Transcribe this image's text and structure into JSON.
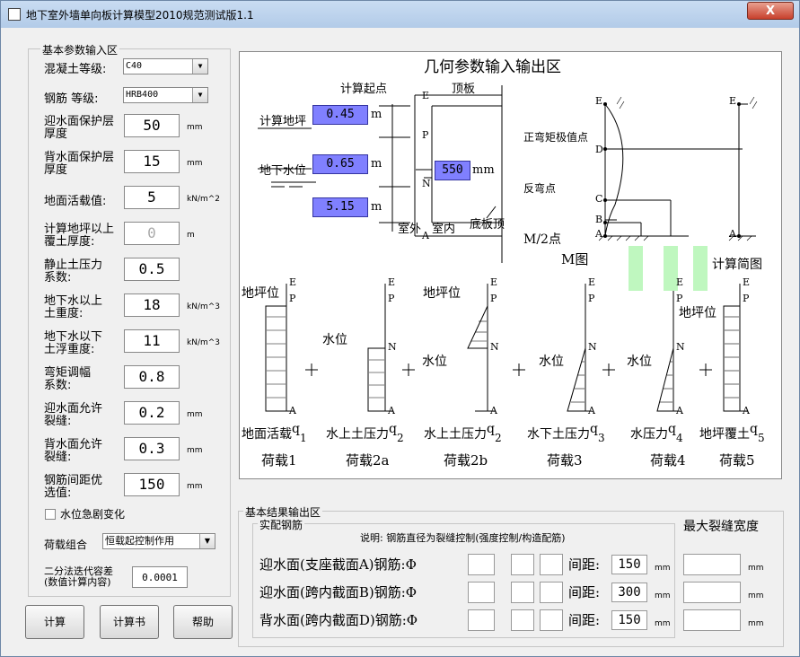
{
  "window": {
    "title": "地下室外墙单向板计算模型2010规范测试版1.1",
    "close": "X"
  },
  "left": {
    "frame_label": "基本参数输入区",
    "concrete_label": "混凝土等级:",
    "concrete_value": "C40",
    "rebar_label": "钢筋   等级:",
    "rebar_value": "HRB400",
    "params": [
      {
        "l1": "迎水面保护层",
        "l2": "厚度",
        "value": "50",
        "unit": "mm"
      },
      {
        "l1": "背水面保护层",
        "l2": "厚度",
        "value": "15",
        "unit": "mm"
      },
      {
        "l1": "地面活载值:",
        "l2": "",
        "value": "5",
        "unit": "kN/m^2"
      },
      {
        "l1": "计算地坪以上",
        "l2": "覆土厚度:",
        "value": "0",
        "unit": "m"
      },
      {
        "l1": "静止土压力",
        "l2": "系数:",
        "value": "0.5",
        "unit": ""
      },
      {
        "l1": "地下水以上",
        "l2": "土重度:",
        "value": "18",
        "unit": "kN/m^3"
      },
      {
        "l1": "地下水以下",
        "l2": "土浮重度:",
        "value": "11",
        "unit": "kN/m^3"
      },
      {
        "l1": "弯矩调幅",
        "l2": "系数:",
        "value": "0.8",
        "unit": ""
      },
      {
        "l1": "迎水面允许",
        "l2": "裂缝:",
        "value": "0.2",
        "unit": "mm"
      },
      {
        "l1": "背水面允许",
        "l2": "裂缝:",
        "value": "0.3",
        "unit": "mm"
      },
      {
        "l1": "钢筋间距优",
        "l2": "选值:",
        "value": "150",
        "unit": "mm"
      }
    ],
    "checkbox_label": "水位急剧变化",
    "load_combo_label": "荷载组合",
    "load_combo_value": "恒载起控制作用",
    "tol_l1": "二分法迭代容差",
    "tol_l2": "(数值计算内容)",
    "tol_value": "0.0001",
    "btn_calc": "计算",
    "btn_book": "计算书",
    "btn_help": "帮助"
  },
  "geo": {
    "title": "几何参数输入输出区",
    "calc_start": "计算起点",
    "top_plate": "顶板",
    "calc_ground": "计算地坪",
    "ground_water": "地下水位",
    "outdoor": "室外",
    "indoor": "室内",
    "bottom_plate": "底板顶",
    "v1": "0.45",
    "v2": "0.65",
    "v3": "5.15",
    "thk": "550",
    "unit_m": "m",
    "unit_mm": "mm",
    "pt_E": "E",
    "pt_P": "P",
    "pt_N": "N",
    "pt_A": "A",
    "pt_D": "D",
    "pt_C": "C",
    "pt_B": "B",
    "pos_moment": "正弯矩极值点",
    "inflection": "反弯点",
    "m2": "M/2点",
    "m_diagram": "M图",
    "calc_diagram": "计算简图",
    "ground_level": "地坪位",
    "water_level": "水位",
    "plus": "+",
    "loads": [
      {
        "l1": "地面活载",
        "q": "q",
        "sub": "1",
        "l2": "荷载1"
      },
      {
        "l1": "水上土压力",
        "q": "q",
        "sub": "2",
        "l2": "荷载2a"
      },
      {
        "l1": "水上土压力",
        "q": "q",
        "sub": "2",
        "l2": "荷载2b"
      },
      {
        "l1": "水下土压力",
        "q": "q",
        "sub": "3",
        "l2": "荷载3"
      },
      {
        "l1": "水压力",
        "q": "q",
        "sub": "4",
        "l2": "荷载4"
      },
      {
        "l1": "地坪覆土",
        "q": "q",
        "sub": "5",
        "l2": "荷载5"
      }
    ]
  },
  "result": {
    "frame_label": "基本结果输出区",
    "sub_label": "实配钢筋",
    "note": "说明: 钢筋直径为裂缝控制(强度控制/构造配筋)",
    "max_crack": "最大裂缝宽度",
    "spacing_label": "间距:",
    "rows": [
      {
        "label": "迎水面(支座截面A)钢筋:Φ",
        "spacing": "150"
      },
      {
        "label": "迎水面(跨内截面B)钢筋:Φ",
        "spacing": "300"
      },
      {
        "label": "背水面(跨内截面D)钢筋:Φ",
        "spacing": "150"
      }
    ],
    "unit": "mm"
  },
  "colors": {
    "highlight": "#8080ff",
    "green": "#bff7bf",
    "close": "#c8402c"
  }
}
